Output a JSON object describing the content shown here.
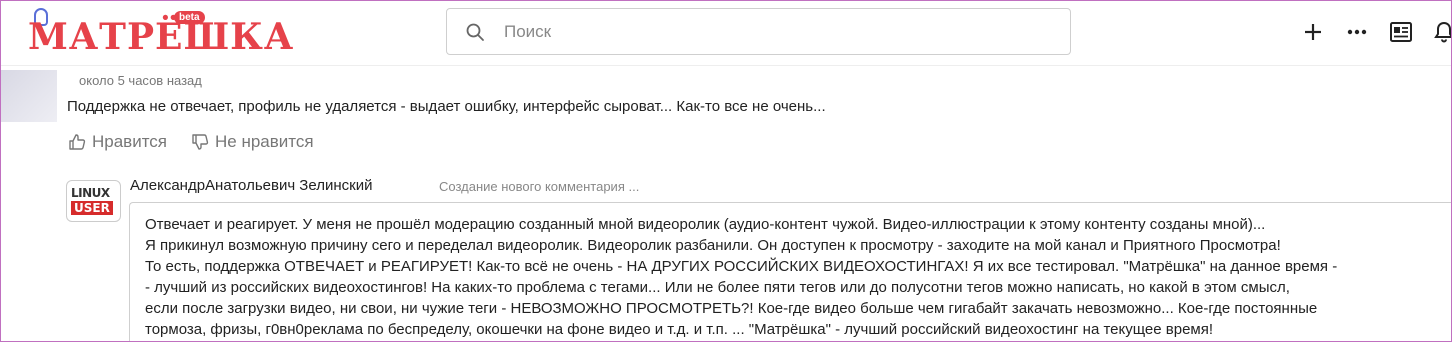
{
  "header": {
    "logo_text": "МАТРЁШКА",
    "logo_badge": "beta",
    "search_placeholder": "Поиск",
    "icons": [
      "search-icon",
      "plus-icon",
      "more-icon",
      "feed-icon",
      "bell-icon"
    ]
  },
  "comment": {
    "time": "около 5 часов назад",
    "text": "Поддержка не отвечает, профиль не удаляется - выдает ошибку, интерфейс сыроват... Как-то все не очень...",
    "like_label": "Нравится",
    "dislike_label": "Не нравится"
  },
  "reply": {
    "avatar_line1": "LINUX",
    "avatar_line2": "USER",
    "author": "АлександрАнатольевич Зелинский",
    "status": "Создание нового комментария ...",
    "text": "Отвечает и реагирует. У меня не прошёл модерацию созданный мной видеоролик (аудио-контент чужой. Видео-иллюстрации к этому контенту созданы мной)...\nЯ прикинул возможную причину сего и переделал видеоролик. Видеоролик разбанили. Он доступен к просмотру - заходите на мой канал и Приятного Просмотра!\nТо есть, поддержка ОТВЕЧАЕТ и РЕАГИРУЕТ! Как-то всё не очень - НА ДРУГИХ РОССИЙСКИХ ВИДЕОХОСТИНГАХ! Я их все тестировал. \"Матрёшка\" на данное время -\n- лучший из российских видеохостингов! На каких-то проблема с тегами... Или не более пяти тегов или до полусотни тегов можно написать, но какой в этом смысл,\nесли после загрузки видео, ни свои, ни чужие теги - НЕВОЗМОЖНО ПРОСМОТРЕТЬ?! Кое-где видео больше чем гигабайт закачать невозможно... Кое-где постоянные\nтормоза, фризы, г0вн0реклама по беспределу, окошечки на фоне видео и т.д. и т.п. ... \"Матрёшка\" - лучший российский видеохостинг на текущее время!"
  },
  "colors": {
    "brand": "#e6424a",
    "muted": "#777777"
  }
}
